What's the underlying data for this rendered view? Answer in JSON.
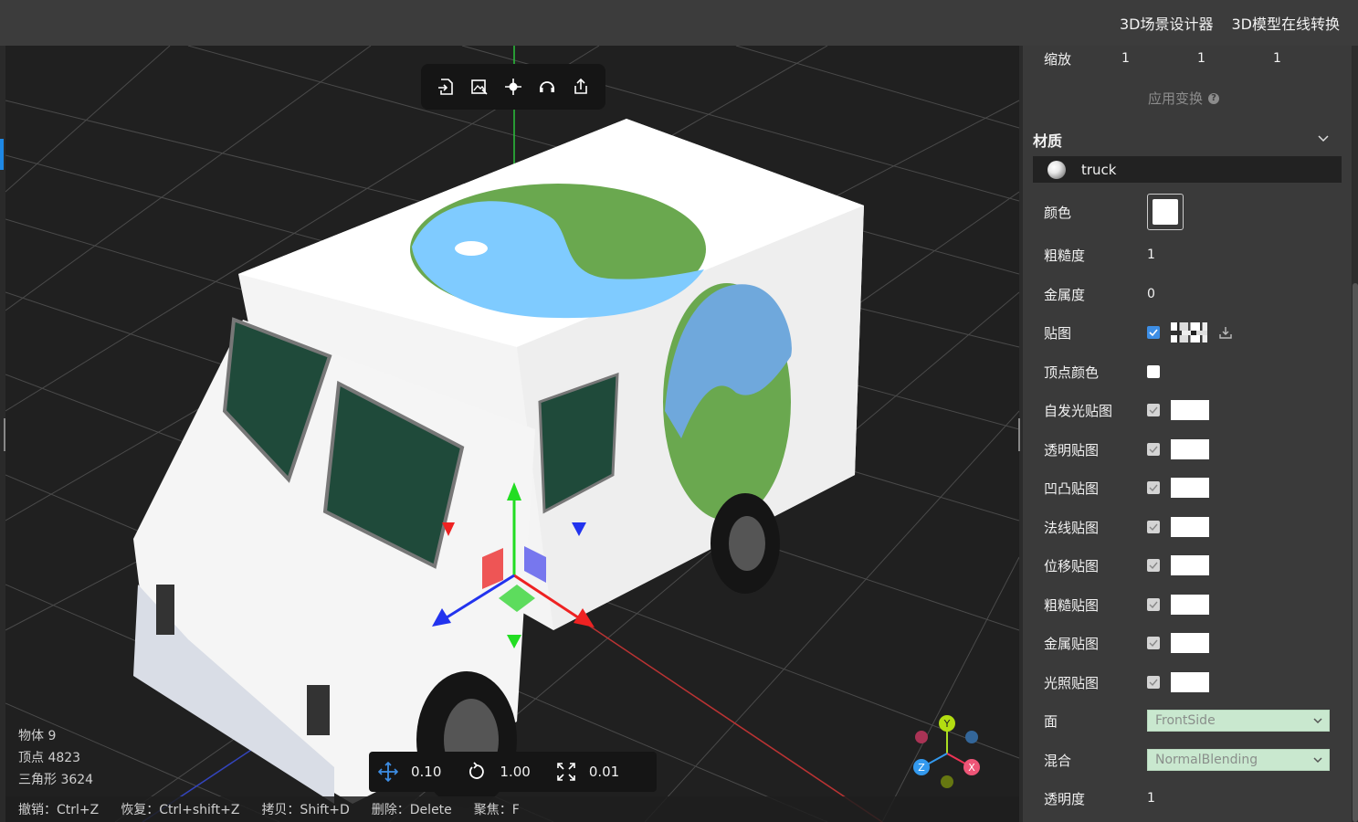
{
  "topbar": {
    "links": [
      "3D场景设计器",
      "3D模型在线转换"
    ]
  },
  "viewport": {
    "toolbar": [
      {
        "icon": "import-icon"
      },
      {
        "icon": "export-image-icon"
      },
      {
        "icon": "locate-icon"
      },
      {
        "icon": "headset-icon"
      },
      {
        "icon": "share-icon"
      }
    ],
    "stats": {
      "objects": "物体 9",
      "vertices": "顶点 4823",
      "triangles": "三角形 3624"
    },
    "snap": {
      "translate": "0.10",
      "rotate": "1.00",
      "scale": "0.01"
    },
    "shortcuts": [
      "撤销：Ctrl+Z",
      "恢复：Ctrl+shift+Z",
      "拷贝：Shift+D",
      "删除：Delete",
      "聚焦：F"
    ],
    "axis_labels": {
      "y": "Y",
      "z": "Z",
      "x": "X"
    }
  },
  "panel": {
    "scale": {
      "label": "缩放",
      "values": [
        "1",
        "1",
        "1"
      ]
    },
    "apply_transform": "应用变换",
    "help": "?",
    "material_title": "材质",
    "material_name": "truck",
    "props": {
      "color": "颜色",
      "roughness": {
        "label": "粗糙度",
        "value": "1"
      },
      "metalness": {
        "label": "金属度",
        "value": "0"
      },
      "map": "贴图",
      "vertex_colors": "顶点颜色",
      "emissive_map": "自发光贴图",
      "alpha_map": "透明贴图",
      "bump_map": "凹凸贴图",
      "normal_map": "法线贴图",
      "displacement_map": "位移贴图",
      "roughness_map": "粗糙贴图",
      "metalness_map": "金属贴图",
      "light_map": "光照贴图",
      "side": {
        "label": "面",
        "value": "FrontSide"
      },
      "blending": {
        "label": "混合",
        "value": "NormalBlending"
      },
      "opacity": {
        "label": "透明度",
        "value": "1"
      }
    },
    "colors": {
      "material_color": "#ffffff",
      "accent": "#3d8ee5",
      "select_bg": "#c9e8cf"
    }
  }
}
